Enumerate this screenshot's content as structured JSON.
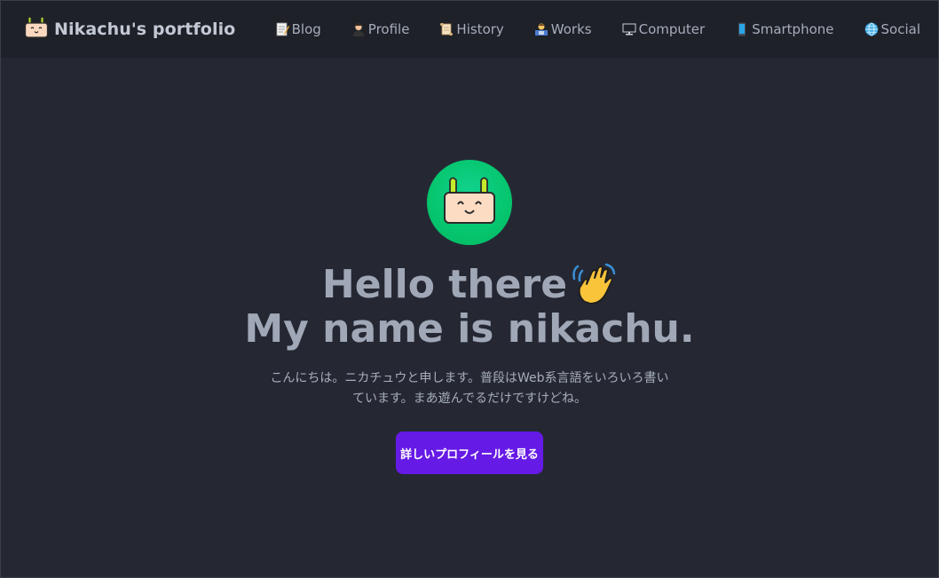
{
  "navbar": {
    "brand": {
      "icon": "mascot-icon",
      "title": "Nikachu's portfolio"
    },
    "items": [
      {
        "icon": "memo-icon",
        "label": "Blog"
      },
      {
        "icon": "profile-icon",
        "label": "Profile"
      },
      {
        "icon": "scroll-icon",
        "label": "History"
      },
      {
        "icon": "technologist-icon",
        "label": "Works"
      },
      {
        "icon": "desktop-computer-icon",
        "label": "Computer"
      },
      {
        "icon": "mobile-phone-icon",
        "label": "Smartphone"
      },
      {
        "icon": "globe-icon",
        "label": "Social"
      }
    ]
  },
  "hero": {
    "avatar_icon": "mascot-icon",
    "headline_line1": "Hello there",
    "wave_icon": "waving-hand-icon",
    "headline_line2": "My name is nikachu.",
    "intro": "こんにちは。ニカチュウと申します。普段はWeb系言語をいろいろ書いています。まあ遊んでるだけですけどね。",
    "cta_label": "詳しいプロフィールを見る"
  },
  "colors": {
    "background": "#252833",
    "navbar": "#1e2128",
    "accent": "#661ae6",
    "avatar": "#05c56d"
  }
}
